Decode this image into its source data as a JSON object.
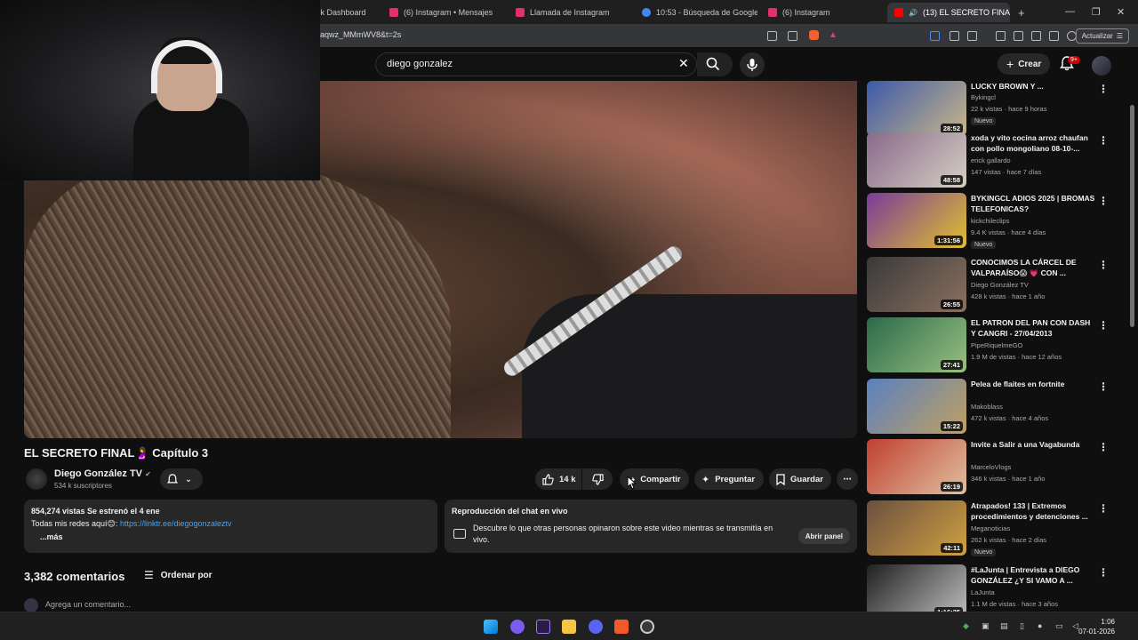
{
  "browser": {
    "tabs": [
      {
        "label": "ck Dashboard",
        "color": "#888888"
      },
      {
        "label": "(6) Instagram • Mensajes",
        "color": "#e1306c"
      },
      {
        "label": "Llamada de Instagram",
        "color": "#e1306c"
      },
      {
        "label": "10:53 - Búsqueda de Google",
        "color": "#4285f4"
      },
      {
        "label": "(6) Instagram",
        "color": "#e1306c"
      },
      {
        "label": "(13) EL SECRETO FINAL",
        "color": "#ff0000"
      }
    ],
    "url": "aqwz_MMmWV8&t=2s",
    "update_label": "Actualizar"
  },
  "header": {
    "search_value": "diego gonzalez",
    "create_label": "Crear",
    "notif_badge": "9+"
  },
  "video": {
    "title": "EL SECRETO FINAL🤰 Capítulo 3",
    "channel": "Diego González TV",
    "subscribers": "534 k suscriptores",
    "likes": "14 k",
    "share_label": "Compartir",
    "ask_label": "Preguntar",
    "save_label": "Guardar"
  },
  "description": {
    "stats": "854,274 vistas  Se estrenó el 4 ene",
    "text": "Todas mis redes aquí😊: ",
    "link": "https://linktr.ee/diegogonzaleztv",
    "more": "...más"
  },
  "chat": {
    "title": "Reproducción del chat en vivo",
    "text": "Descubre lo que otras personas opinaron sobre este video mientras se transmitía en vivo.",
    "button": "Abrir panel"
  },
  "comments": {
    "count": "3,382 comentarios",
    "sort_label": "Ordenar por",
    "add_placeholder": "Agrega un comentario..."
  },
  "sidebar": [
    {
      "title": "LUCKY BROWN Y ...",
      "channel": "Bykingcl",
      "meta": "22 k vistas · hace 9 horas",
      "dur": "28:52",
      "new": "Nuevo",
      "c1": "#3b5aa8",
      "c2": "#c9b58a"
    },
    {
      "title": "xoda y vito cocina arroz chaufan con pollo mongoliano 08-10-...",
      "channel": "erick gallardo",
      "meta": "147 vistas · hace 7 días",
      "dur": "48:58",
      "new": "",
      "c1": "#8a6a8a",
      "c2": "#d4cfc4"
    },
    {
      "title": "BYKINGCL ADIOS 2025 | BROMAS TELEFONICAS?",
      "channel": "kickchileclips",
      "meta": "9.4 K vistas · hace 4 días",
      "dur": "1:31:56",
      "new": "Nuevo",
      "c1": "#7a3b9a",
      "c2": "#e0c030"
    },
    {
      "title": "CONOCIMOS LA CÁRCEL DE VALPARAÍSO😱 💗 CON ...",
      "channel": "Diego González TV",
      "meta": "428 k vistas · hace 1 año",
      "dur": "26:55",
      "new": "",
      "c1": "#3a3a3a",
      "c2": "#8a7060"
    },
    {
      "title": "EL PATRON DEL PAN CON DASH Y CANGRI - 27/04/2013",
      "channel": "PipeRiquelmeGO",
      "meta": "1.9 M de vistas · hace 12 años",
      "dur": "27:41",
      "new": "",
      "c1": "#2a6a4a",
      "c2": "#9ac080"
    },
    {
      "title": "Pelea de flaites en fortnite",
      "channel": "Makoblass",
      "meta": "472 k vistas · hace 4 años",
      "dur": "15:22",
      "new": "",
      "c1": "#5a80c0",
      "c2": "#c0a060"
    },
    {
      "title": "Invite a Salir a una Vagabunda",
      "channel": "MarceloVlogs",
      "meta": "346 k vistas · hace 1 año",
      "dur": "26:19",
      "new": "",
      "c1": "#c04030",
      "c2": "#e0c0a0"
    },
    {
      "title": "Atrapados! 133 | Extremos procedimientos y detenciones ...",
      "channel": "Meganoticias",
      "meta": "262 k vistas · hace 2 días",
      "dur": "42:11",
      "new": "Nuevo",
      "c1": "#6a5040",
      "c2": "#d0a040"
    },
    {
      "title": "#LaJunta | Entrevista a DIEGO GONZÁLEZ ¿Y SI VAMO A ...",
      "channel": "LaJunta",
      "meta": "1.1 M de vistas · hace 3 años",
      "dur": "1:16:25",
      "new": "",
      "c1": "#202020",
      "c2": "#c0c0c0"
    }
  ],
  "taskbar": {
    "time": "1:06",
    "date": "07-01-2026"
  }
}
